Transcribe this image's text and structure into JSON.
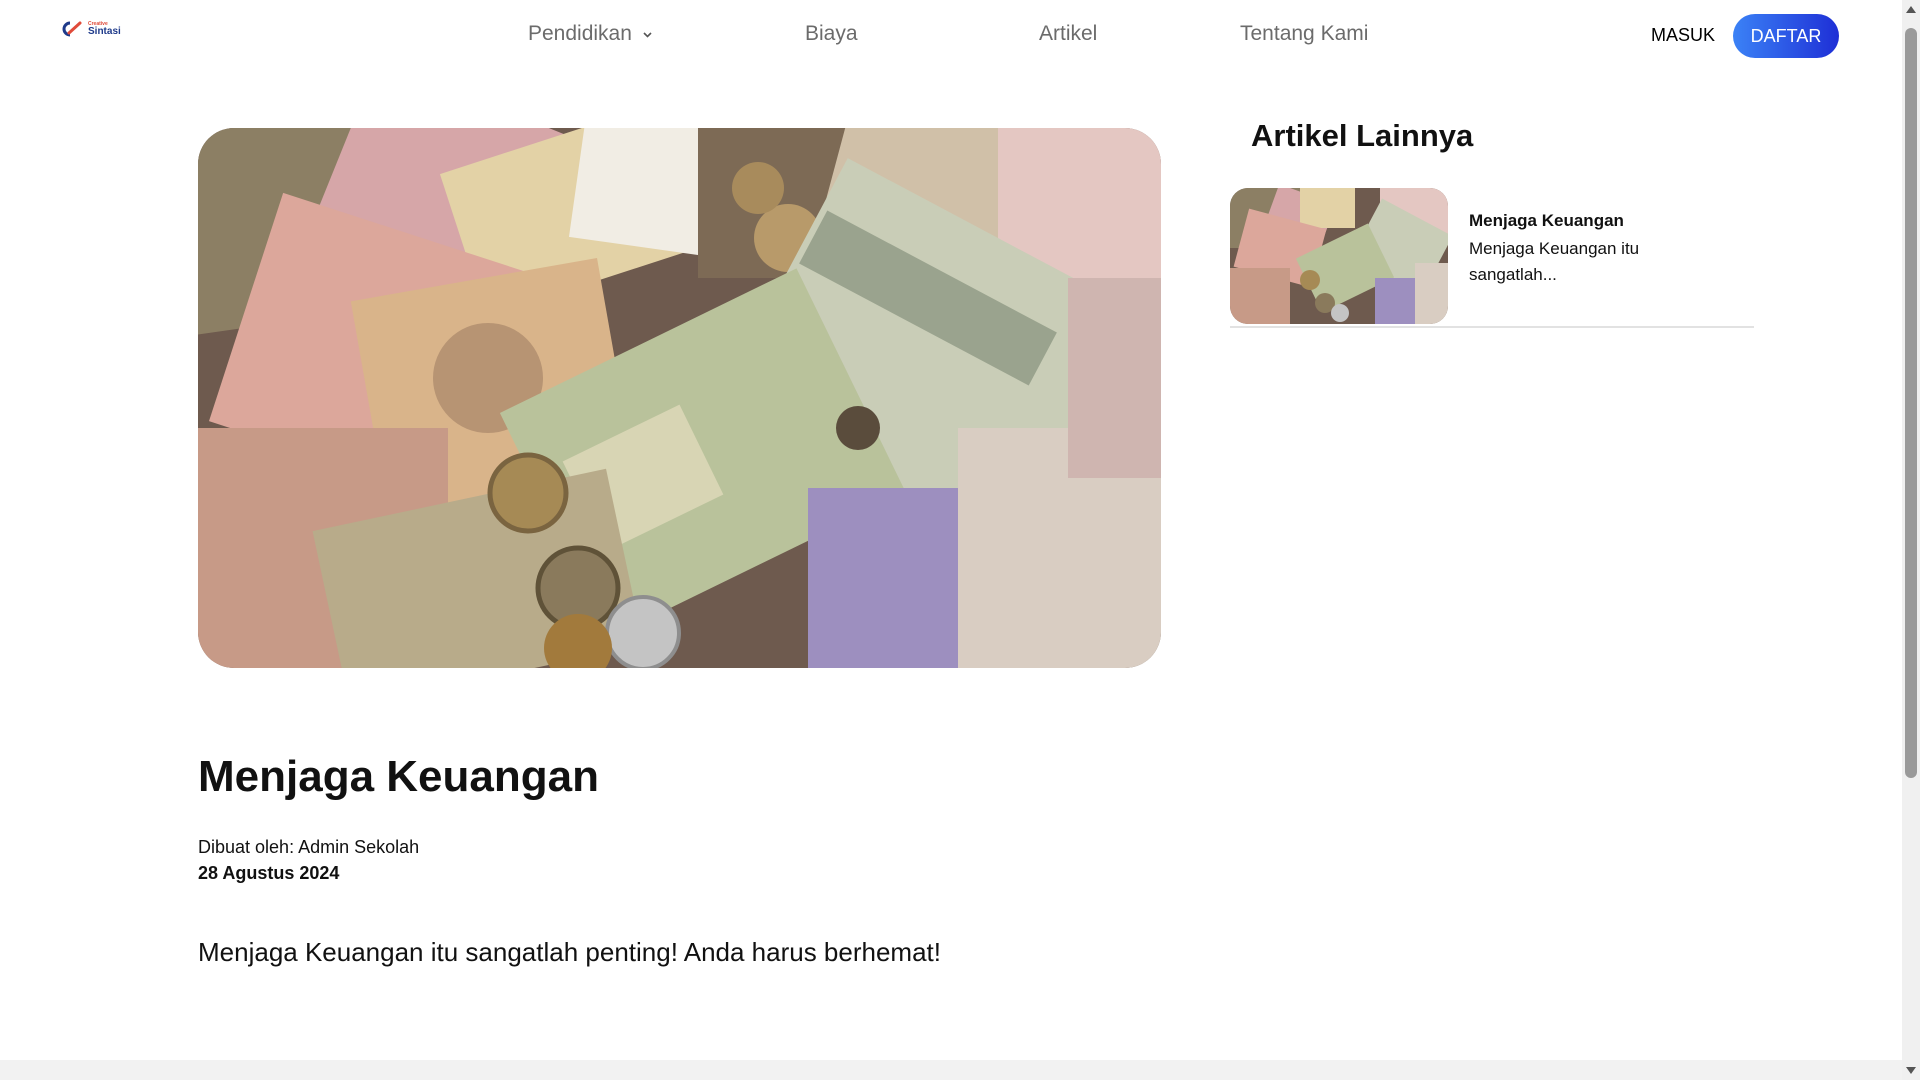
{
  "header": {
    "logo": {
      "small_text": "Creative",
      "name": "Sintasi"
    },
    "nav": [
      {
        "label": "Pendidikan",
        "has_dropdown": true
      },
      {
        "label": "Biaya"
      },
      {
        "label": "Artikel"
      },
      {
        "label": "Tentang Kami"
      }
    ],
    "login_label": "MASUK",
    "register_label": "DAFTAR"
  },
  "article": {
    "image_icon": "money-banknotes-image",
    "title": "Menjaga Keuangan",
    "author": "Dibuat oleh: Admin Sekolah",
    "date": "28 Agustus 2024",
    "body": "Menjaga Keuangan itu sangatlah penting! Anda harus berhemat!"
  },
  "sidebar": {
    "title": "Artikel Lainnya",
    "cards": [
      {
        "title": "Menjaga Keuangan",
        "excerpt": "Menjaga Keuangan itu sangatlah..."
      }
    ]
  },
  "colors": {
    "accent_gradient_start": "#3b82f6",
    "accent_gradient_end": "#1e2fd6",
    "nav_text": "#6b6b6b"
  }
}
